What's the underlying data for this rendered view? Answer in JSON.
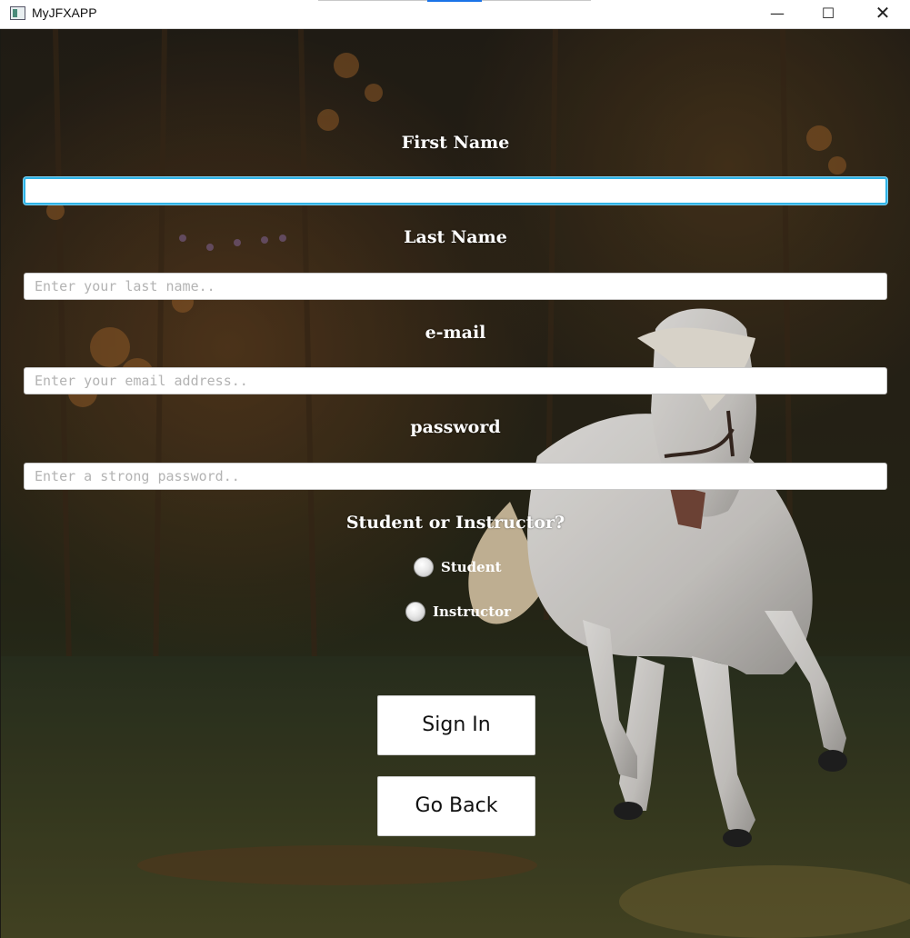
{
  "window": {
    "title": "MyJFXAPP",
    "minimize_glyph": "—",
    "maximize_glyph": "☐",
    "close_glyph": "✕"
  },
  "form": {
    "first_name_label": "First Name",
    "first_name_value": "",
    "first_name_placeholder": "",
    "last_name_label": "Last Name",
    "last_name_placeholder": "Enter your last name..",
    "email_label": "e-mail",
    "email_placeholder": "Enter your email address..",
    "password_label": "password",
    "password_placeholder": "Enter a strong password..",
    "role_question": "Student or Instructor?",
    "role_options": [
      "Student",
      "Instructor"
    ],
    "sign_in_label": "Sign In",
    "go_back_label": "Go Back"
  },
  "background": {
    "subject": "white horse running in forest",
    "colors": {
      "forest_dark": "#1d2118",
      "foliage_orange": "#8a5a2a",
      "grass": "#3b4426",
      "horse": "#e6e3df"
    }
  },
  "accent": {
    "focus_border": "#2fb3e6"
  }
}
